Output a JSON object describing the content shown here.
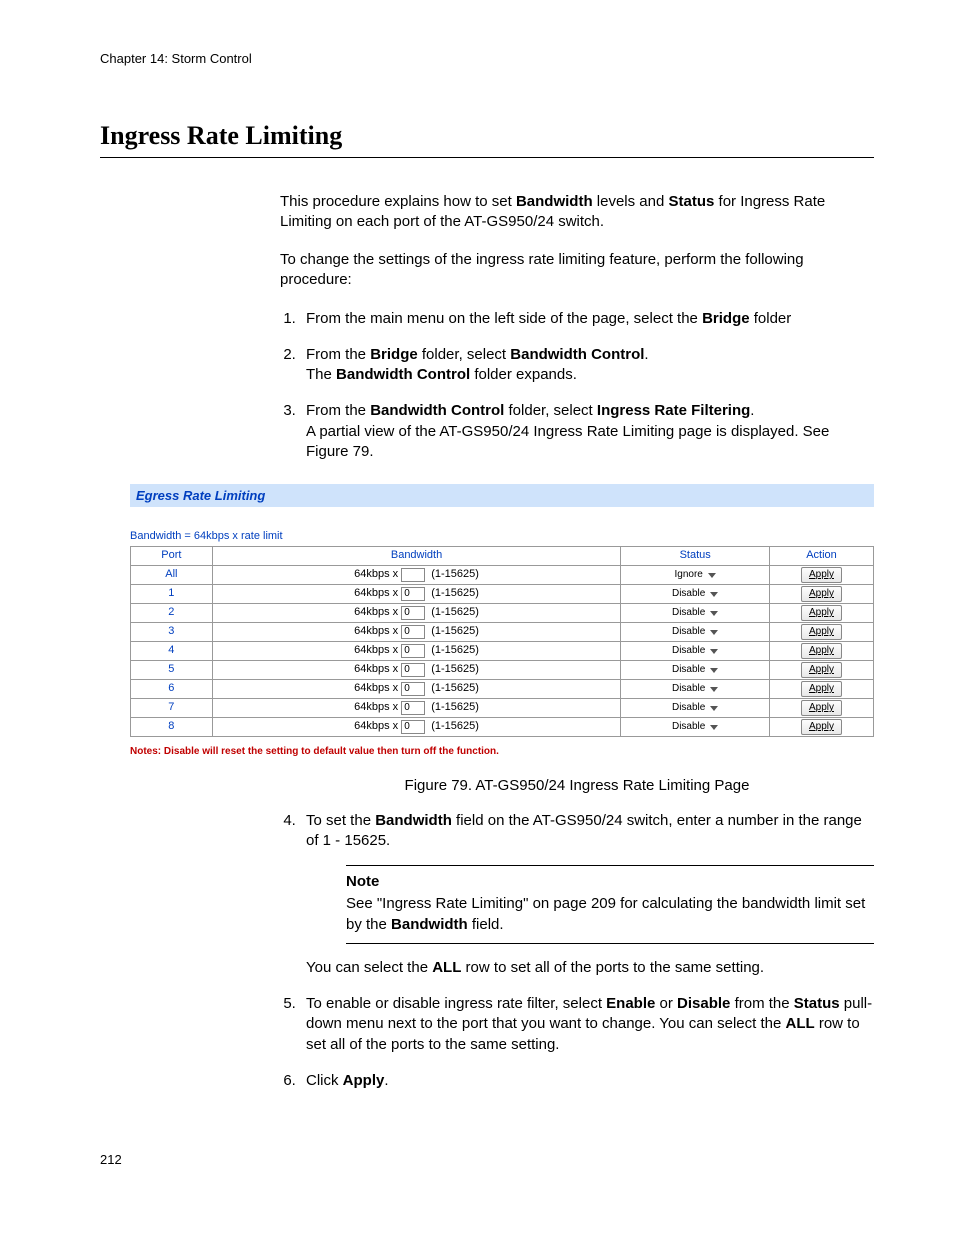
{
  "chapter": "Chapter 14: Storm Control",
  "heading": "Ingress Rate Limiting",
  "intro1_pre": "This procedure explains how to set ",
  "intro1_b1": "Bandwidth",
  "intro1_mid": " levels and ",
  "intro1_b2": "Status",
  "intro1_post": " for Ingress Rate Limiting on each port of the AT-GS950/24 switch.",
  "intro2": "To change the settings of the ingress rate limiting feature, perform the following procedure:",
  "s1_pre": "From the main menu on the left side of the page, select the ",
  "s1_b": "Bridge",
  "s1_post": " folder",
  "s2_l1_pre": "From the ",
  "s2_l1_b1": "Bridge",
  "s2_l1_mid": " folder, select ",
  "s2_l1_b2": "Bandwidth Control",
  "s2_l1_post": ".",
  "s2_l2_pre": "The ",
  "s2_l2_b": "Bandwidth Control",
  "s2_l2_post": " folder expands.",
  "s3_l1_pre": "From the ",
  "s3_l1_b1": "Bandwidth Control",
  "s3_l1_mid": " folder, select ",
  "s3_l1_b2": "Ingress Rate Filtering",
  "s3_l1_post": ".",
  "s3_l2": "A partial view of the AT-GS950/24 Ingress Rate Limiting page is displayed. See Figure 79.",
  "panel": {
    "title": "Egress Rate Limiting",
    "formula": "Bandwidth = 64kbps x rate limit",
    "headers": {
      "port": "Port",
      "bandwidth": "Bandwidth",
      "status": "Status",
      "action": "Action"
    },
    "bw_prefix": "64kbps x",
    "range": "(1-15625)",
    "apply": "Apply",
    "rows": [
      {
        "port": "All",
        "val": "",
        "status": "Ignore"
      },
      {
        "port": "1",
        "val": "0",
        "status": "Disable"
      },
      {
        "port": "2",
        "val": "0",
        "status": "Disable"
      },
      {
        "port": "3",
        "val": "0",
        "status": "Disable"
      },
      {
        "port": "4",
        "val": "0",
        "status": "Disable"
      },
      {
        "port": "5",
        "val": "0",
        "status": "Disable"
      },
      {
        "port": "6",
        "val": "0",
        "status": "Disable"
      },
      {
        "port": "7",
        "val": "0",
        "status": "Disable"
      },
      {
        "port": "8",
        "val": "0",
        "status": "Disable"
      }
    ],
    "notes": "Notes: Disable will reset the setting to default value then turn off the function."
  },
  "fig_caption": "Figure 79. AT-GS950/24 Ingress Rate Limiting Page",
  "s4_pre": "To set the ",
  "s4_b": "Bandwidth",
  "s4_post": " field on the AT-GS950/24 switch, enter a number in the range of 1 - 15625.",
  "note_head": "Note",
  "note_body_pre": "See \"Ingress Rate Limiting\" on page 209 for calculating the bandwidth limit set by the ",
  "note_body_b": "Bandwidth",
  "note_body_post": " field.",
  "after_note_pre": "You can select the ",
  "after_note_b": "ALL",
  "after_note_post": " row to set all of the ports to the same setting.",
  "s5_pre": "To enable or disable ingress rate filter, select ",
  "s5_b1": "Enable",
  "s5_mid1": " or ",
  "s5_b2": "Disable",
  "s5_mid2": " from the ",
  "s5_b3": "Status",
  "s5_mid3": " pull-down menu next to the port that you want to change. You can select the ",
  "s5_b4": "ALL",
  "s5_post": " row to set all of the ports to the same setting.",
  "s6_pre": "Click ",
  "s6_b": "Apply",
  "s6_post": ".",
  "page": "212"
}
